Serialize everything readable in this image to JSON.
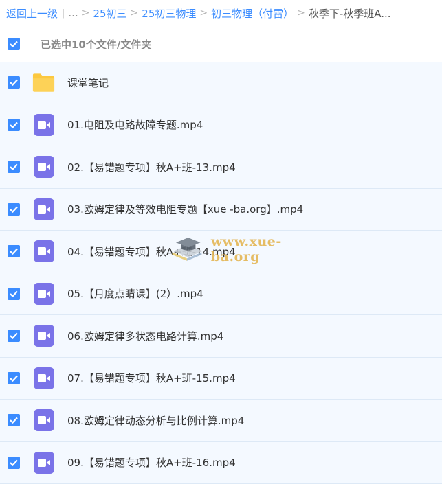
{
  "breadcrumb": {
    "back": "返回上一级",
    "ellipsis": "...",
    "items": [
      "25初三",
      "25初三物理",
      "初三物理（付雷）"
    ],
    "current": "秋季下-秋季班A..."
  },
  "selection": {
    "label": "已选中10个文件/文件夹"
  },
  "files": [
    {
      "name": "课堂笔记",
      "type": "folder-icon"
    },
    {
      "name": "01.电阻及电路故障专题.mp4",
      "type": "video-icon"
    },
    {
      "name": "02.【易错题专项】秋A+班-13.mp4",
      "type": "video-icon"
    },
    {
      "name": "03.欧姆定律及等效电阻专题【xue -ba.org】.mp4",
      "type": "video-icon"
    },
    {
      "name": "04.【易错题专项】秋A+班-14.mp4",
      "type": "video-icon"
    },
    {
      "name": "05.【月度点睛课】(2）.mp4",
      "type": "video-icon"
    },
    {
      "name": "06.欧姆定律多状态电路计算.mp4",
      "type": "video-icon"
    },
    {
      "name": "07.【易错题专项】秋A+班-15.mp4",
      "type": "video-icon"
    },
    {
      "name": "08.欧姆定律动态分析与比例计算.mp4",
      "type": "video-icon"
    },
    {
      "name": "09.【易错题专项】秋A+班-16.mp4",
      "type": "video-icon"
    }
  ],
  "watermark": {
    "text": "www.xue-ba.org"
  },
  "colors": {
    "accent": "#3b8cff",
    "video": "#7a73e8",
    "folder": "#fcc83f",
    "row_bg": "#f4f9ff"
  }
}
